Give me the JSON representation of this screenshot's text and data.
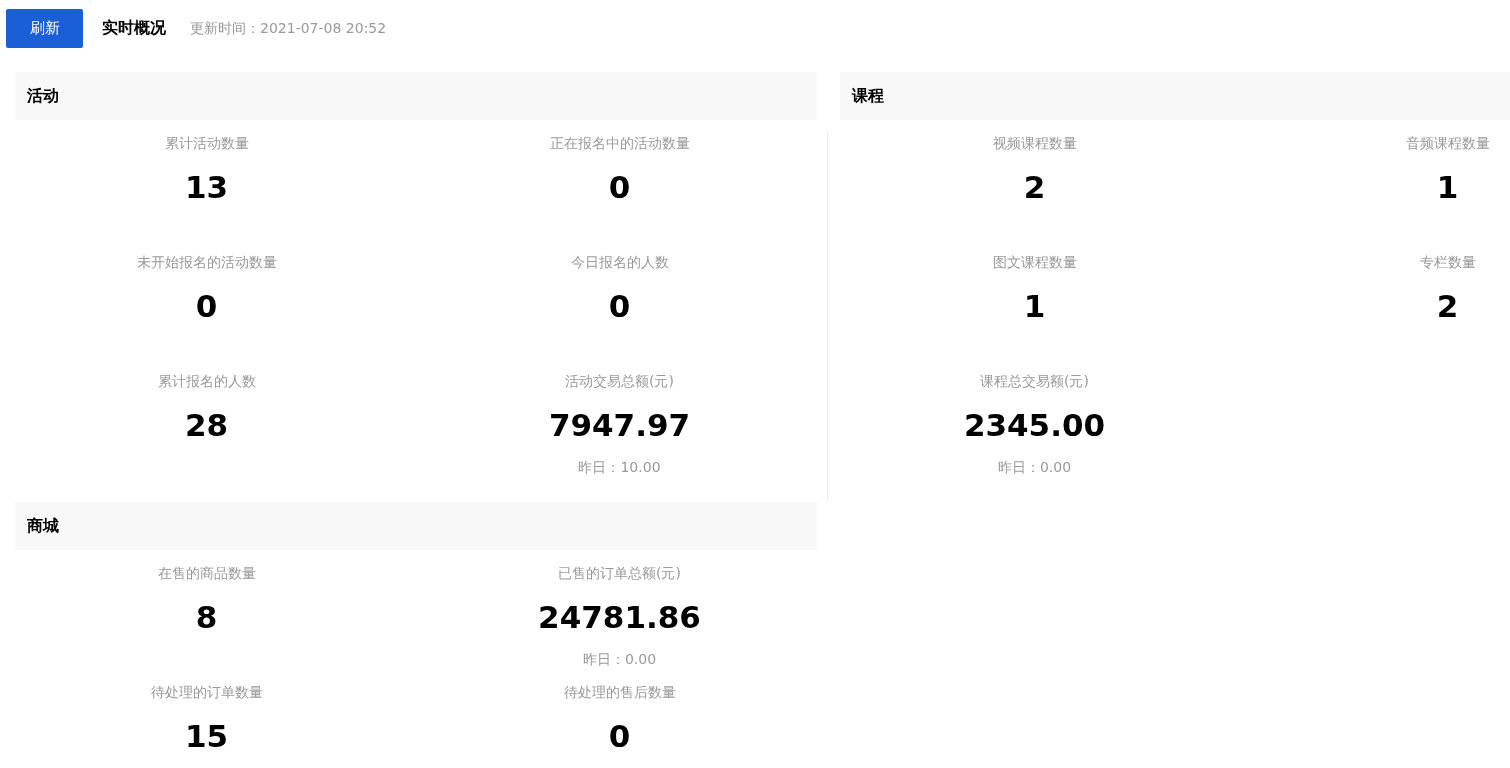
{
  "toolbar": {
    "refresh_button": "刷新",
    "title": "实时概况",
    "update_time": "更新时间：2021-07-08 20:52"
  },
  "sections": [
    {
      "title": "活动",
      "items": [
        {
          "label": "累计活动数量",
          "value": "13"
        },
        {
          "label": "正在报名中的活动数量",
          "value": "0"
        },
        {
          "label": "未开始报名的活动数量",
          "value": "0"
        },
        {
          "label": "今日报名的人数",
          "value": "0"
        },
        {
          "label": "累计报名的人数",
          "value": "28"
        },
        {
          "label": "活动交易总额(元)",
          "value": "7947.97",
          "yesterday": "昨日：10.00"
        }
      ]
    },
    {
      "title": "课程",
      "items": [
        {
          "label": "视频课程数量",
          "value": "2"
        },
        {
          "label": "音频课程数量",
          "value": "1"
        },
        {
          "label": "图文课程数量",
          "value": "1"
        },
        {
          "label": "专栏数量",
          "value": "2"
        },
        {
          "label": "课程总交易额(元)",
          "value": "2345.00",
          "yesterday": "昨日：0.00"
        }
      ]
    },
    {
      "title": "商城",
      "items": [
        {
          "label": "在售的商品数量",
          "value": "8"
        },
        {
          "label": "已售的订单总额(元)",
          "value": "24781.86",
          "yesterday": "昨日：0.00"
        },
        {
          "label": "待处理的订单数量",
          "value": "15"
        },
        {
          "label": "待处理的售后数量",
          "value": "0"
        }
      ]
    }
  ]
}
